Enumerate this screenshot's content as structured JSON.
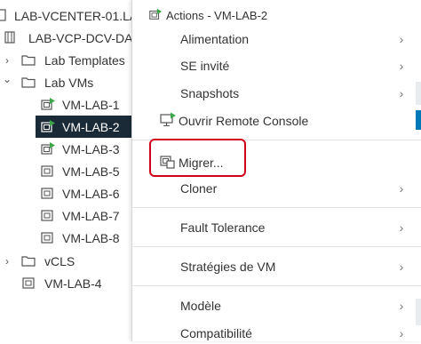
{
  "tree": {
    "items": [
      {
        "label": "LAB-VCENTER-01.LA",
        "icon": "vcenter-icon",
        "caret": ""
      },
      {
        "label": "LAB-VCP-DCV-DA",
        "icon": "datacenter-icon",
        "caret": ""
      },
      {
        "label": "Lab Templates",
        "icon": "folder-icon",
        "caret": "›"
      },
      {
        "label": "Lab VMs",
        "icon": "folder-icon",
        "caret": "⌄"
      },
      {
        "label": "VM-LAB-1",
        "icon": "vm-powered-on-icon",
        "caret": ""
      },
      {
        "label": "VM-LAB-2",
        "icon": "vm-powered-on-icon",
        "caret": ""
      },
      {
        "label": "VM-LAB-3",
        "icon": "vm-powered-on-icon",
        "caret": ""
      },
      {
        "label": "VM-LAB-5",
        "icon": "vm-icon",
        "caret": ""
      },
      {
        "label": "VM-LAB-6",
        "icon": "vm-icon",
        "caret": ""
      },
      {
        "label": "VM-LAB-7",
        "icon": "vm-icon",
        "caret": ""
      },
      {
        "label": "VM-LAB-8",
        "icon": "vm-icon",
        "caret": ""
      },
      {
        "label": "vCLS",
        "icon": "folder-icon",
        "caret": "›"
      },
      {
        "label": "VM-LAB-4",
        "icon": "vm-icon",
        "caret": ""
      }
    ],
    "selected": "VM-LAB-2"
  },
  "menu": {
    "header": "Actions - VM-LAB-2",
    "items": [
      {
        "label": "Alimentation",
        "submenu": true
      },
      {
        "label": "SE invité",
        "submenu": true
      },
      {
        "label": "Snapshots",
        "submenu": true
      },
      {
        "label": "Ouvrir Remote Console",
        "submenu": false
      },
      {
        "label": "Migrer...",
        "submenu": false
      },
      {
        "label": "Cloner",
        "submenu": true
      },
      {
        "label": "Fault Tolerance",
        "submenu": true
      },
      {
        "label": "Stratégies de VM",
        "submenu": true
      },
      {
        "label": "Modèle",
        "submenu": true
      },
      {
        "label": "Compatibilité",
        "submenu": true
      }
    ],
    "highlighted": "Migrer..."
  },
  "colors": {
    "selection": "#1b2a37",
    "vm_power_on": "#3aa648",
    "highlight_box": "#d0021b"
  }
}
